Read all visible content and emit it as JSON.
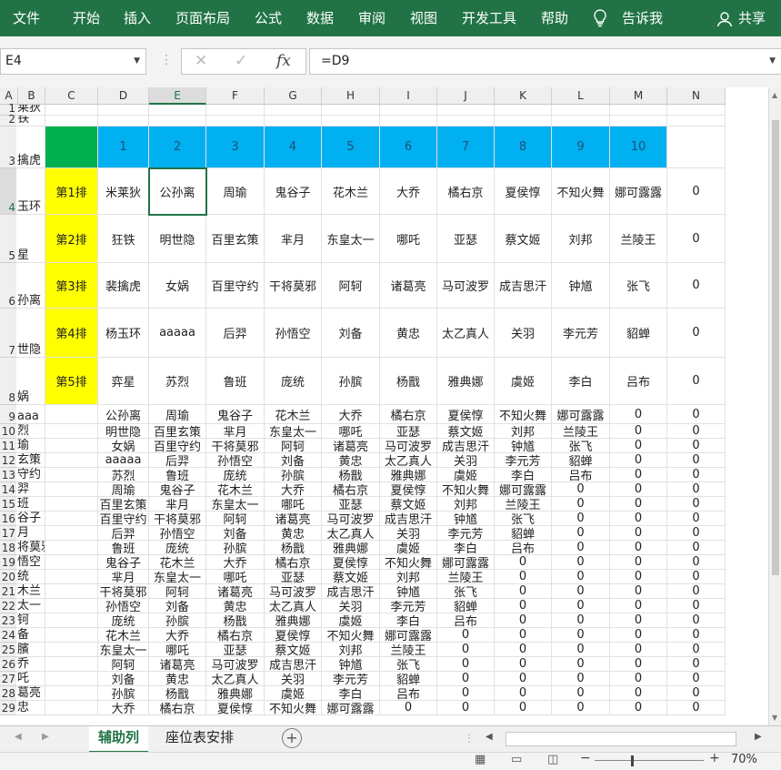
{
  "ribbon": {
    "tabs": [
      "文件",
      "开始",
      "插入",
      "页面布局",
      "公式",
      "数据",
      "审阅",
      "视图",
      "开发工具",
      "帮助"
    ],
    "tell_me": "告诉我",
    "share": "共享"
  },
  "formula_bar": {
    "name_box": "E4",
    "formula": "=D9"
  },
  "sheet": {
    "column_headers": [
      "A",
      "B",
      "C",
      "D",
      "E",
      "F",
      "G",
      "H",
      "I",
      "J",
      "K",
      "L",
      "M",
      "N"
    ],
    "selected_column": "E",
    "selected_row": "4",
    "row_labels": [
      "1",
      "2",
      "3",
      "4",
      "5",
      "6",
      "7",
      "8",
      "9",
      "10",
      "11",
      "12",
      "13",
      "14",
      "15",
      "16",
      "17",
      "18",
      "19",
      "20",
      "21",
      "22",
      "23",
      "24",
      "25",
      "26",
      "27",
      "28",
      "29"
    ],
    "col_a_visible": [
      "莱狄",
      "铁",
      "擒虎",
      "玉环",
      "星",
      "孙离",
      "世隐",
      "娲",
      "aaa",
      "烈",
      "瑜",
      "玄策",
      "守约",
      "羿",
      "班",
      "谷子",
      "月",
      "将莫邪",
      "悟空",
      "统",
      "木兰",
      "太一",
      "钶",
      "备",
      "臏",
      "乔",
      "吒",
      "葛亮",
      "忠"
    ],
    "seat_numbers": [
      "1",
      "2",
      "3",
      "4",
      "5",
      "6",
      "7",
      "8",
      "9",
      "10"
    ],
    "row_labels_yellow": [
      "第1排",
      "第2排",
      "第3排",
      "第4排",
      "第5排"
    ],
    "seating": [
      [
        "米莱狄",
        "公孙离",
        "周瑜",
        "鬼谷子",
        "花木兰",
        "大乔",
        "橘右京",
        "夏侯惇",
        "不知火舞",
        "娜可露露"
      ],
      [
        "狂铁",
        "明世隐",
        "百里玄策",
        "芈月",
        "东皇太一",
        "哪吒",
        "亚瑟",
        "蔡文姬",
        "刘邦",
        "兰陵王"
      ],
      [
        "裴擒虎",
        "女娲",
        "百里守约",
        "干将莫邪",
        "阿轲",
        "诸葛亮",
        "马可波罗",
        "成吉思汗",
        "钟馗",
        "张飞"
      ],
      [
        "杨玉环",
        "aaaaa",
        "后羿",
        "孙悟空",
        "刘备",
        "黄忠",
        "太乙真人",
        "关羽",
        "李元芳",
        "貂蝉"
      ],
      [
        "弈星",
        "苏烈",
        "鲁班",
        "庞统",
        "孙膑",
        "杨戬",
        "雅典娜",
        "虞姬",
        "李白",
        "吕布"
      ]
    ],
    "seating_col_n": [
      "0",
      "0",
      "0",
      "0",
      "0"
    ],
    "helper_rows": [
      [
        "公孙离",
        "周瑜",
        "鬼谷子",
        "花木兰",
        "大乔",
        "橘右京",
        "夏侯惇",
        "不知火舞",
        "娜可露露",
        "0",
        "0"
      ],
      [
        "明世隐",
        "百里玄策",
        "芈月",
        "东皇太一",
        "哪吒",
        "亚瑟",
        "蔡文姬",
        "刘邦",
        "兰陵王",
        "0",
        "0"
      ],
      [
        "女娲",
        "百里守约",
        "干将莫邪",
        "阿轲",
        "诸葛亮",
        "马可波罗",
        "成吉思汗",
        "钟馗",
        "张飞",
        "0",
        "0"
      ],
      [
        "aaaaa",
        "后羿",
        "孙悟空",
        "刘备",
        "黄忠",
        "太乙真人",
        "关羽",
        "李元芳",
        "貂蝉",
        "0",
        "0"
      ],
      [
        "苏烈",
        "鲁班",
        "庞统",
        "孙膑",
        "杨戬",
        "雅典娜",
        "虞姬",
        "李白",
        "吕布",
        "0",
        "0"
      ],
      [
        "周瑜",
        "鬼谷子",
        "花木兰",
        "大乔",
        "橘右京",
        "夏侯惇",
        "不知火舞",
        "娜可露露",
        "0",
        "0",
        "0"
      ],
      [
        "百里玄策",
        "芈月",
        "东皇太一",
        "哪吒",
        "亚瑟",
        "蔡文姬",
        "刘邦",
        "兰陵王",
        "0",
        "0",
        "0"
      ],
      [
        "百里守约",
        "干将莫邪",
        "阿轲",
        "诸葛亮",
        "马可波罗",
        "成吉思汗",
        "钟馗",
        "张飞",
        "0",
        "0",
        "0"
      ],
      [
        "后羿",
        "孙悟空",
        "刘备",
        "黄忠",
        "太乙真人",
        "关羽",
        "李元芳",
        "貂蝉",
        "0",
        "0",
        "0"
      ],
      [
        "鲁班",
        "庞统",
        "孙膑",
        "杨戬",
        "雅典娜",
        "虞姬",
        "李白",
        "吕布",
        "0",
        "0",
        "0"
      ],
      [
        "鬼谷子",
        "花木兰",
        "大乔",
        "橘右京",
        "夏侯惇",
        "不知火舞",
        "娜可露露",
        "0",
        "0",
        "0",
        "0"
      ],
      [
        "芈月",
        "东皇太一",
        "哪吒",
        "亚瑟",
        "蔡文姬",
        "刘邦",
        "兰陵王",
        "0",
        "0",
        "0",
        "0"
      ],
      [
        "干将莫邪",
        "阿轲",
        "诸葛亮",
        "马可波罗",
        "成吉思汗",
        "钟馗",
        "张飞",
        "0",
        "0",
        "0",
        "0"
      ],
      [
        "孙悟空",
        "刘备",
        "黄忠",
        "太乙真人",
        "关羽",
        "李元芳",
        "貂蝉",
        "0",
        "0",
        "0",
        "0"
      ],
      [
        "庞统",
        "孙膑",
        "杨戬",
        "雅典娜",
        "虞姬",
        "李白",
        "吕布",
        "0",
        "0",
        "0",
        "0"
      ],
      [
        "花木兰",
        "大乔",
        "橘右京",
        "夏侯惇",
        "不知火舞",
        "娜可露露",
        "0",
        "0",
        "0",
        "0",
        "0"
      ],
      [
        "东皇太一",
        "哪吒",
        "亚瑟",
        "蔡文姬",
        "刘邦",
        "兰陵王",
        "0",
        "0",
        "0",
        "0",
        "0"
      ],
      [
        "阿轲",
        "诸葛亮",
        "马可波罗",
        "成吉思汗",
        "钟馗",
        "张飞",
        "0",
        "0",
        "0",
        "0",
        "0"
      ],
      [
        "刘备",
        "黄忠",
        "太乙真人",
        "关羽",
        "李元芳",
        "貂蝉",
        "0",
        "0",
        "0",
        "0",
        "0"
      ],
      [
        "孙膑",
        "杨戬",
        "雅典娜",
        "虞姬",
        "李白",
        "吕布",
        "0",
        "0",
        "0",
        "0",
        "0"
      ],
      [
        "大乔",
        "橘右京",
        "夏侯惇",
        "不知火舞",
        "娜可露露",
        "0",
        "0",
        "0",
        "0",
        "0",
        "0"
      ]
    ]
  },
  "sheet_tabs": [
    "辅助列",
    "座位表安排"
  ],
  "active_sheet": "辅助列",
  "status": {
    "zoom": "70%"
  },
  "colors": {
    "ribbon": "#217346",
    "header_blue": "#00b0f0",
    "row_label_yellow": "#ffff00",
    "corner_green": "#00b050"
  }
}
